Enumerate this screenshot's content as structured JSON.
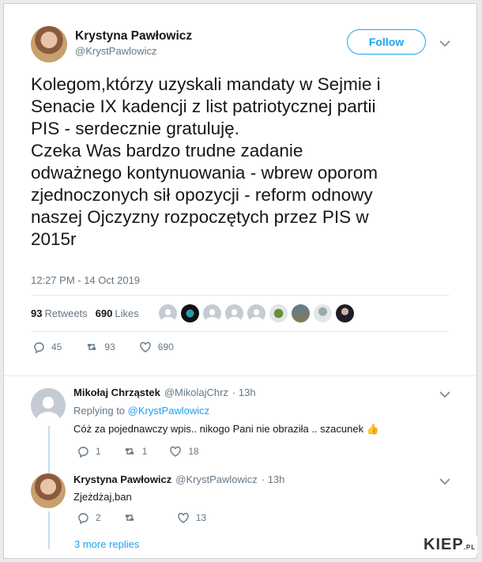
{
  "tweet": {
    "author_name": "Krystyna Pawłowicz",
    "author_handle": "@KrystPawlowicz",
    "follow_label": "Follow",
    "text": "Kolegom,którzy uzyskali mandaty w Sejmie i\nSenacie IX kadencji z list patriotycznej partii\nPIS - serdecznie gratuluję.\nCzeka Was bardzo trudne zadanie\nodważnego kontynuowania - wbrew oporom\nzjednoczonych sił opozycji - reform odnowy\nnaszej Ojczyzny rozpoczętych przez PIS w\n2015r",
    "timestamp": "12:27 PM - 14 Oct 2019",
    "retweets_count": "93",
    "retweets_label": "Retweets",
    "likes_count": "690",
    "likes_label": "Likes",
    "actions": {
      "replies": "45",
      "retweets": "93",
      "likes": "690"
    }
  },
  "replies": [
    {
      "name": "Mikołaj Chrząstek",
      "handle": "@MikolajChrz",
      "time": "· 13h",
      "replying_prefix": "Replying to",
      "replying_to": "@KrystPawlowicz",
      "text": "Cóż za pojednawczy wpis.. nikogo Pani nie obraziła .. szacunek 👍",
      "actions": {
        "replies": "1",
        "retweets": "1",
        "likes": "18"
      }
    },
    {
      "name": "Krystyna Pawłowicz",
      "handle": "@KrystPawlowicz",
      "time": "· 13h",
      "text": "Zjeżdżaj,ban",
      "actions": {
        "replies": "2",
        "retweets": "",
        "likes": "13"
      }
    }
  ],
  "more_replies": "3 more replies",
  "watermark": {
    "main": "KIEP",
    "suffix": ".PL"
  },
  "colors": {
    "accent": "#1da1f2",
    "muted": "#657786",
    "text": "#14171a"
  }
}
